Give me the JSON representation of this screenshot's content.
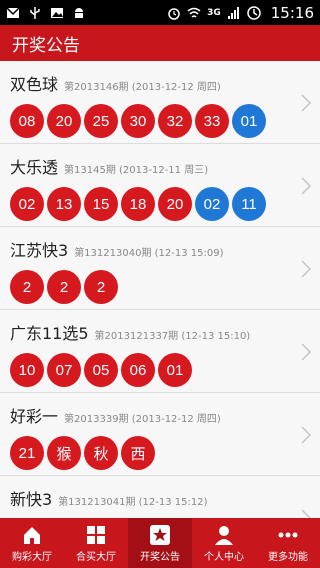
{
  "status_bar": {
    "network": "3G",
    "time": "15:16"
  },
  "app_bar": {
    "title": "开奖公告"
  },
  "lotteries": [
    {
      "name": "双色球",
      "meta": "第2013146期  (2013-12-12 周四)",
      "balls": [
        {
          "v": "08",
          "c": "red"
        },
        {
          "v": "20",
          "c": "red"
        },
        {
          "v": "25",
          "c": "red"
        },
        {
          "v": "30",
          "c": "red"
        },
        {
          "v": "32",
          "c": "red"
        },
        {
          "v": "33",
          "c": "red"
        },
        {
          "v": "01",
          "c": "blue"
        }
      ]
    },
    {
      "name": "大乐透",
      "meta": "第13145期  (2013-12-11 周三)",
      "balls": [
        {
          "v": "02",
          "c": "red"
        },
        {
          "v": "13",
          "c": "red"
        },
        {
          "v": "15",
          "c": "red"
        },
        {
          "v": "18",
          "c": "red"
        },
        {
          "v": "20",
          "c": "red"
        },
        {
          "v": "02",
          "c": "blue"
        },
        {
          "v": "11",
          "c": "blue"
        }
      ]
    },
    {
      "name": "江苏快3",
      "meta": "第131213040期  (12-13 15:09)",
      "balls": [
        {
          "v": "2",
          "c": "red"
        },
        {
          "v": "2",
          "c": "red"
        },
        {
          "v": "2",
          "c": "red"
        }
      ]
    },
    {
      "name": "广东11选5",
      "meta": "第2013121337期  (12-13 15:10)",
      "balls": [
        {
          "v": "10",
          "c": "red"
        },
        {
          "v": "07",
          "c": "red"
        },
        {
          "v": "05",
          "c": "red"
        },
        {
          "v": "06",
          "c": "red"
        },
        {
          "v": "01",
          "c": "red"
        }
      ]
    },
    {
      "name": "好彩一",
      "meta": "第2013339期  (2013-12-12 周四)",
      "balls": [
        {
          "v": "21",
          "c": "red"
        },
        {
          "v": "猴",
          "c": "red"
        },
        {
          "v": "秋",
          "c": "red"
        },
        {
          "v": "西",
          "c": "red"
        }
      ]
    },
    {
      "name": "新快3",
      "meta": "第131213041期  (12-13 15:12)",
      "balls": []
    }
  ],
  "tabs": [
    {
      "label": "购彩大厅",
      "icon": "home-icon",
      "active": false
    },
    {
      "label": "合买大厅",
      "icon": "grid-icon",
      "active": false
    },
    {
      "label": "开奖公告",
      "icon": "star-icon",
      "active": true
    },
    {
      "label": "个人中心",
      "icon": "person-icon",
      "active": false
    },
    {
      "label": "更多功能",
      "icon": "more-icon",
      "active": false
    }
  ]
}
